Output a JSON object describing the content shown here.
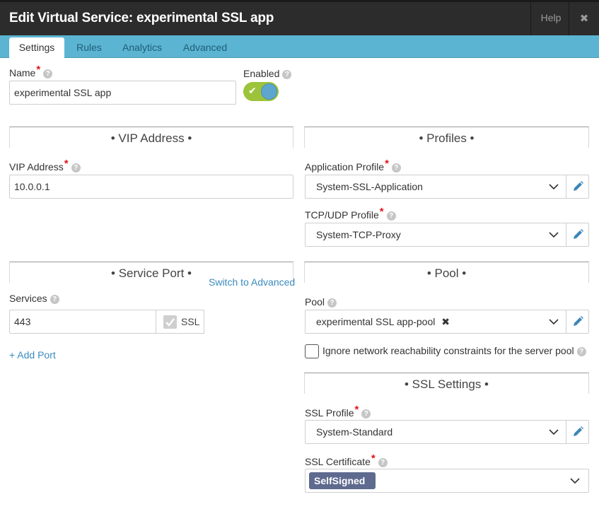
{
  "header": {
    "title": "Edit Virtual Service: experimental SSL app",
    "help_label": "Help",
    "close_glyph": "✖"
  },
  "tabs": [
    {
      "label": "Settings",
      "active": true
    },
    {
      "label": "Rules",
      "active": false
    },
    {
      "label": "Analytics",
      "active": false
    },
    {
      "label": "Advanced",
      "active": false
    }
  ],
  "name_field": {
    "label": "Name",
    "value": "experimental SSL app",
    "required": true
  },
  "enabled": {
    "label": "Enabled",
    "on": true
  },
  "sections": {
    "vip": "• VIP Address •",
    "profiles": "• Profiles •",
    "service_port": "• Service Port •",
    "pool": "• Pool •",
    "ssl_settings": "• SSL Settings •"
  },
  "vip_address": {
    "label": "VIP Address",
    "value": "10.0.0.1"
  },
  "application_profile": {
    "label": "Application Profile",
    "value": "System-SSL-Application"
  },
  "tcp_udp_profile": {
    "label": "TCP/UDP Profile",
    "value": "System-TCP-Proxy"
  },
  "service_port": {
    "switch_label": "Switch to Advanced",
    "services_label": "Services",
    "port_value": "443",
    "ssl_label": "SSL",
    "add_port_label": "+ Add Port"
  },
  "pool": {
    "label": "Pool",
    "value": "experimental SSL app-pool",
    "ignore_label": "Ignore network reachability constraints for the server pool"
  },
  "ssl_profile": {
    "label": "SSL Profile",
    "value": "System-Standard"
  },
  "ssl_certificate": {
    "label": "SSL Certificate",
    "tag": "SelfSigned"
  },
  "colors": {
    "accent_tab_bar": "#5bb4d1",
    "toggle_on": "#9cc33a",
    "link": "#3a8bbf",
    "tag": "#5f6a8f"
  }
}
